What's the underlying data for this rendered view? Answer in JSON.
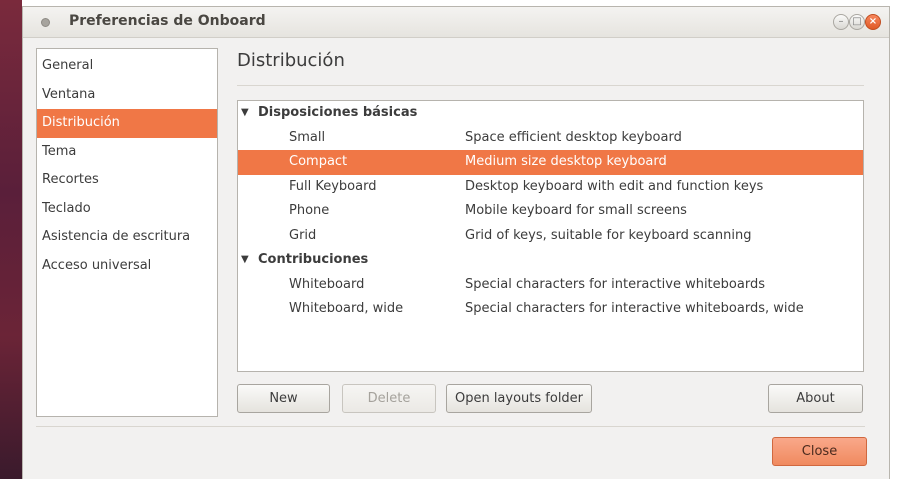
{
  "window": {
    "title": "Preferencias de Onboard",
    "controls": [
      "minimize-icon",
      "maximize-icon",
      "close-icon"
    ]
  },
  "sidebar": {
    "items": [
      {
        "label": "General",
        "selected": false
      },
      {
        "label": "Ventana",
        "selected": false
      },
      {
        "label": "Distribución",
        "selected": true
      },
      {
        "label": "Tema",
        "selected": false
      },
      {
        "label": "Recortes",
        "selected": false
      },
      {
        "label": "Teclado",
        "selected": false
      },
      {
        "label": "Asistencia de escritura",
        "selected": false
      },
      {
        "label": "Acceso universal",
        "selected": false
      }
    ]
  },
  "main": {
    "title": "Distribución",
    "groups": [
      {
        "label": "Disposiciones básicas",
        "expander": "▼",
        "items": [
          {
            "name": "Small",
            "description": "Space efficient desktop keyboard",
            "selected": false
          },
          {
            "name": "Compact",
            "description": "Medium size desktop keyboard",
            "selected": true
          },
          {
            "name": "Full Keyboard",
            "description": "Desktop keyboard with edit and function keys",
            "selected": false
          },
          {
            "name": "Phone",
            "description": "Mobile keyboard for small screens",
            "selected": false
          },
          {
            "name": "Grid",
            "description": "Grid of keys, suitable for keyboard scanning",
            "selected": false
          }
        ]
      },
      {
        "label": "Contribuciones",
        "expander": "▼",
        "items": [
          {
            "name": "Whiteboard",
            "description": "Special characters for interactive whiteboards",
            "selected": false
          },
          {
            "name": "Whiteboard, wide",
            "description": "Special characters for interactive whiteboards, wide",
            "selected": false
          }
        ]
      }
    ],
    "buttons": {
      "new": "New",
      "delete": "Delete",
      "open_folder": "Open layouts folder",
      "about": "About"
    }
  },
  "footer": {
    "close": "Close"
  },
  "colors": {
    "accent": "#f07746",
    "window_bg": "#f2f1f0",
    "close_button": "#f08a5f"
  }
}
